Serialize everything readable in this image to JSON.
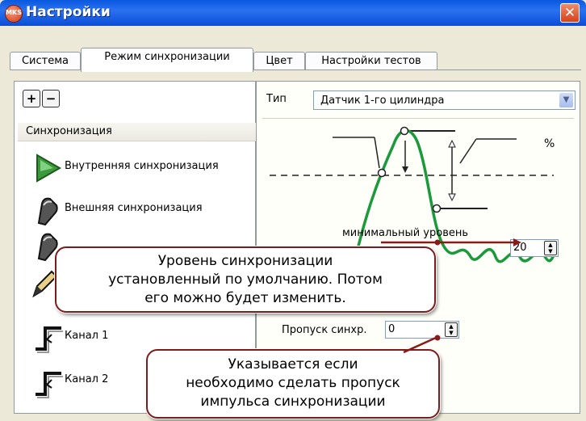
{
  "window": {
    "title": "Настройки",
    "app_badge": "MKS"
  },
  "tabs": [
    {
      "label": "Система",
      "active": false
    },
    {
      "label": "Режим синхронизации",
      "active": true
    },
    {
      "label": "Цвет",
      "active": false
    },
    {
      "label": "Настройки тестов",
      "active": false
    }
  ],
  "toolbar": {
    "add_symbol": "+",
    "remove_symbol": "−"
  },
  "sync_list": {
    "header": "Синхронизация",
    "items": [
      {
        "label": "Внутренняя синхронизация",
        "icon": "play-triangle-icon"
      },
      {
        "label": "Внешняя синхронизация",
        "icon": "probe-clip-icon"
      },
      {
        "label": "",
        "icon": "probe-clip-icon"
      },
      {
        "label": "",
        "icon": "pencil-icon"
      },
      {
        "label": "Канал 1",
        "icon": "rising-edge-icon"
      },
      {
        "label": "Канал 2",
        "icon": "rising-edge-icon"
      }
    ]
  },
  "settings": {
    "type_label": "Тип",
    "type_value": "Датчик 1-го цилиндра",
    "percent_label": "%",
    "min_level_label": "минимальный уровень",
    "min_level_value": "20",
    "skip_label": "Пропуск синхр.",
    "skip_value": "0"
  },
  "callouts": {
    "level_text": "Уровень синхронизации\nустановленный по умолчанию. Потом\nего можно будет изменить.",
    "skip_text": "Указывается если\nнеобходимо сделать пропуск\nимпульса синхронизации"
  },
  "colors": {
    "titlebar": "#0a58e0",
    "wave": "#1a9a3a",
    "callout_border": "#7b1c1c",
    "arrow": "#8a1a1a"
  }
}
